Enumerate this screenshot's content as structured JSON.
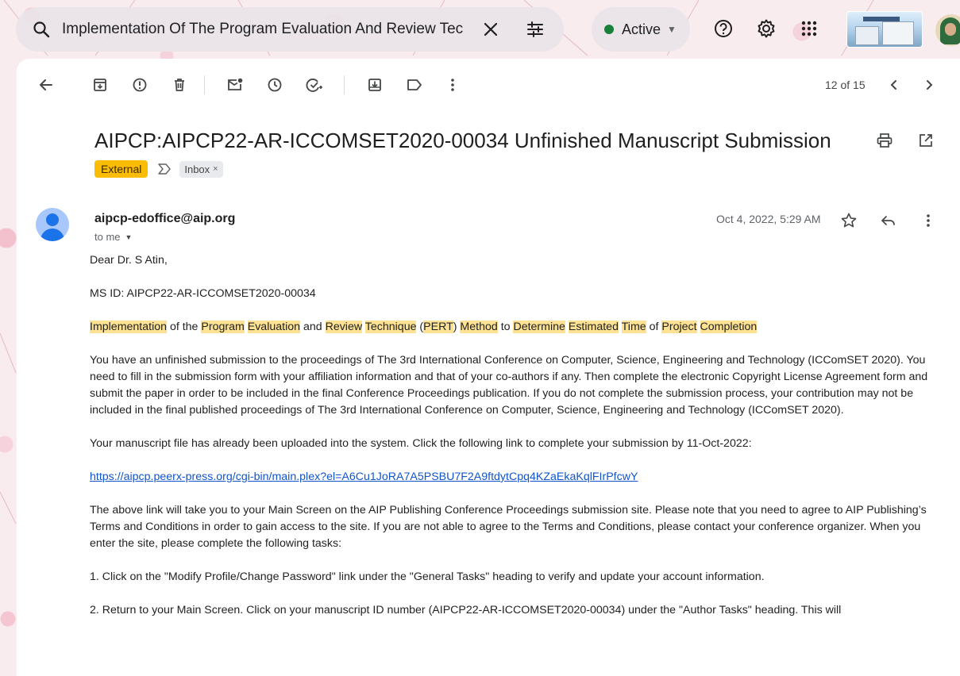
{
  "search": {
    "query": "Implementation Of The Program Evaluation And Review Tec"
  },
  "status": {
    "label": "Active",
    "dot_color": "#188038"
  },
  "icons": {
    "search": "search-icon",
    "clear": "close-icon",
    "filters": "tune-icon",
    "status_chevron": "chevron-down-icon",
    "help": "help-icon",
    "settings": "gear-icon",
    "apps": "apps-grid-icon",
    "back": "arrow-back-icon",
    "archive": "archive-icon",
    "report_spam": "report-icon",
    "delete": "trash-icon",
    "mark_unread": "mark-unread-icon",
    "snooze": "clock-icon",
    "add_task": "add-task-icon",
    "move_to": "move-to-icon",
    "labels": "label-icon",
    "more": "more-vert-icon",
    "prev": "chevron-left-icon",
    "next": "chevron-right-icon",
    "print": "print-icon",
    "open_new": "open-in-new-icon",
    "star": "star-icon",
    "reply": "reply-icon"
  },
  "pager": {
    "text": "12 of 15"
  },
  "email": {
    "subject": "AIPCP:AIPCP22-AR-ICCOMSET2020-00034 Unfinished Manuscript Submission",
    "labels": {
      "external": "External",
      "inbox": "Inbox",
      "inbox_remove": "×"
    },
    "sender": "aipcp-edoffice@aip.org",
    "to": "to me",
    "date": "Oct 4, 2022, 5:29 AM",
    "greeting": "Dear Dr. S Atin,",
    "ms_id": "MS ID: AIPCP22-AR-ICCOMSET2020-00034",
    "title_parts": [
      {
        "text": "Implementation",
        "hl": true
      },
      {
        "text": " of the ",
        "hl": false
      },
      {
        "text": "Program",
        "hl": true
      },
      {
        "text": " ",
        "hl": false
      },
      {
        "text": "Evaluation",
        "hl": true
      },
      {
        "text": " and ",
        "hl": false
      },
      {
        "text": "Review",
        "hl": true
      },
      {
        "text": " ",
        "hl": false
      },
      {
        "text": "Technique",
        "hl": true
      },
      {
        "text": " (",
        "hl": false
      },
      {
        "text": "PERT",
        "hl": true
      },
      {
        "text": ") ",
        "hl": false
      },
      {
        "text": "Method",
        "hl": true
      },
      {
        "text": " to ",
        "hl": false
      },
      {
        "text": "Determine",
        "hl": true
      },
      {
        "text": " ",
        "hl": false
      },
      {
        "text": "Estimated",
        "hl": true
      },
      {
        "text": " ",
        "hl": false
      },
      {
        "text": "Time",
        "hl": true
      },
      {
        "text": " of ",
        "hl": false
      },
      {
        "text": "Project",
        "hl": true
      },
      {
        "text": " ",
        "hl": false
      },
      {
        "text": "Completion",
        "hl": true
      }
    ],
    "para1": "You have an unfinished submission to the proceedings of The 3rd International Conference on Computer, Science, Engineering and Technology (ICComSET 2020). You need to fill in the submission form with your affiliation information and that of your co-authors if any. Then complete the electronic Copyright License Agreement form and submit the paper in order to be included in the final Conference Proceedings publication. If you do not complete the submission process, your contribution may not be included in the final published proceedings of The 3rd International Conference on Computer, Science, Engineering and Technology (ICComSET 2020).",
    "para2": "Your manuscript file has already been uploaded into the system. Click the following link to complete your submission by 11-Oct-2022:",
    "link": "https://aipcp.peerx-press.org/cgi-bin/main.plex?el=A6Cu1JoRA7A5PSBU7F2A9ftdytCpq4KZaEkaKqlFIrPfcwY",
    "para3": "The above link will take you to your Main Screen on the AIP Publishing Conference Proceedings submission site. Please note that you need to agree to AIP Publishing’s Terms and Conditions in order to gain access to the site. If you are not able to agree to the Terms and Conditions, please contact your conference organizer. When you enter the site, please complete the following tasks:",
    "step1": "1. Click on the \"Modify Profile/Change Password\" link under the \"General Tasks\" heading to verify and update your account information.",
    "step2": "2. Return to your Main Screen. Click on your manuscript ID number (AIPCP22-AR-ICCOMSET2020-00034) under the \"Author Tasks\" heading. This will"
  }
}
